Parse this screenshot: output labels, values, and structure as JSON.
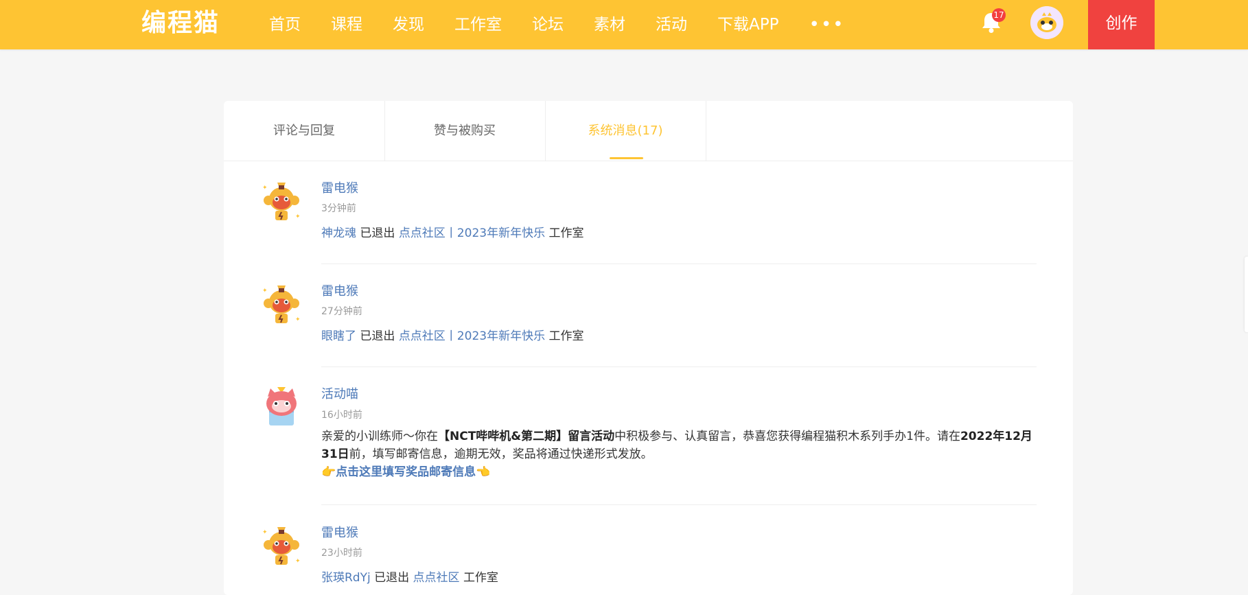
{
  "app": {
    "logo_text": "编程猫",
    "nav": [
      "首页",
      "课程",
      "发现",
      "工作室",
      "论坛",
      "素材",
      "活动",
      "下载APP"
    ],
    "more_label": "•••",
    "notification_count": "17",
    "create_label": "创作",
    "brand_color": "#fec433",
    "create_color": "#f0423f"
  },
  "tabs": [
    {
      "label": "评论与回复",
      "active": false
    },
    {
      "label": "赞与被购买",
      "active": false
    },
    {
      "label": "系统消息(17)",
      "active": true
    }
  ],
  "messages": [
    {
      "sender": "雷电猴",
      "avatar_icon": "thunder-monkey-icon",
      "time": "3分钟前",
      "user": "神龙魂",
      "action": "已退出",
      "studio": "点点社区丨2023年新年快乐",
      "suffix": "工作室"
    },
    {
      "sender": "雷电猴",
      "avatar_icon": "thunder-monkey-icon",
      "time": "27分钟前",
      "user": "眼瞎了",
      "action": "已退出",
      "studio": "点点社区丨2023年新年快乐",
      "suffix": "工作室"
    },
    {
      "sender": "活动喵",
      "avatar_icon": "activity-cat-icon",
      "time": "16小时前",
      "text_part1": "亲爱的小训练师～你在",
      "text_bold1": "【NCT哔哔机&第二期】留言活动",
      "text_part2": "中积极参与、认真留言，恭喜您获得编程猫积木系列手办1件。请在",
      "text_bold2": "2022年12月31日",
      "text_part3": "前，填写邮寄信息，逾期无效，奖品将通过快递形式发放。",
      "link_prefix": "👉",
      "link_text": "点击这里填写奖品邮寄信息",
      "link_suffix": "👈"
    },
    {
      "sender": "雷电猴",
      "avatar_icon": "thunder-monkey-icon",
      "time": "23小时前",
      "user": "张瑛RdYj",
      "action": "已退出",
      "studio": "点点社区",
      "suffix": "工作室"
    }
  ]
}
